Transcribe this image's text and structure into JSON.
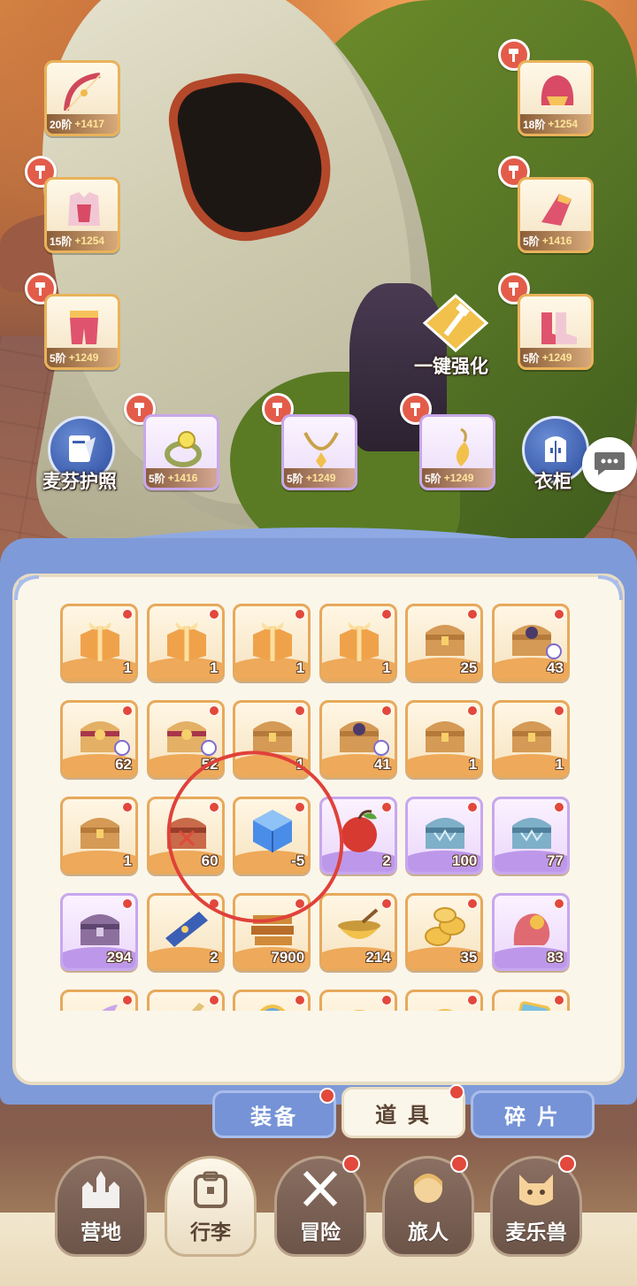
{
  "equipment": [
    {
      "id": "bow",
      "level": "20阶",
      "bonus": "+1417",
      "hammer": false,
      "rarity": "gold"
    },
    {
      "id": "helmet",
      "level": "18阶",
      "bonus": "+1254",
      "hammer": true,
      "rarity": "gold"
    },
    {
      "id": "armor",
      "level": "15阶",
      "bonus": "+1254",
      "hammer": true,
      "rarity": "gold"
    },
    {
      "id": "gloves",
      "level": "5阶",
      "bonus": "+1416",
      "hammer": true,
      "rarity": "gold"
    },
    {
      "id": "pants",
      "level": "5阶",
      "bonus": "+1249",
      "hammer": true,
      "rarity": "gold"
    },
    {
      "id": "boots",
      "level": "5阶",
      "bonus": "+1249",
      "hammer": true,
      "rarity": "gold"
    },
    {
      "id": "ring",
      "level": "5阶",
      "bonus": "+1416",
      "hammer": true,
      "rarity": "purple"
    },
    {
      "id": "necklace",
      "level": "5阶",
      "bonus": "+1249",
      "hammer": true,
      "rarity": "purple"
    },
    {
      "id": "earring",
      "level": "5阶",
      "bonus": "+1249",
      "hammer": true,
      "rarity": "purple"
    }
  ],
  "buttons": {
    "passport": "麦芬护照",
    "wardrobe": "衣柜",
    "upgrade_all": "一键强化"
  },
  "inventory": {
    "items": [
      {
        "icon": "gift-box",
        "count": "1",
        "rarity": "gold"
      },
      {
        "icon": "gift-box",
        "count": "1",
        "rarity": "gold"
      },
      {
        "icon": "gift-box",
        "count": "1",
        "rarity": "gold"
      },
      {
        "icon": "gift-box",
        "count": "1",
        "rarity": "gold"
      },
      {
        "icon": "treasure-chest",
        "count": "25",
        "rarity": "gold"
      },
      {
        "icon": "treasure-chest-badge",
        "count": "43",
        "rarity": "gold"
      },
      {
        "icon": "fancy-chest",
        "count": "62",
        "rarity": "gold"
      },
      {
        "icon": "fancy-chest",
        "count": "52",
        "rarity": "gold"
      },
      {
        "icon": "treasure-chest",
        "count": "1",
        "rarity": "gold"
      },
      {
        "icon": "treasure-chest-badge",
        "count": "41",
        "rarity": "gold"
      },
      {
        "icon": "treasure-chest",
        "count": "1",
        "rarity": "gold"
      },
      {
        "icon": "treasure-chest",
        "count": "1",
        "rarity": "gold"
      },
      {
        "icon": "treasure-chest",
        "count": "1",
        "rarity": "gold"
      },
      {
        "icon": "red-treasure-chest",
        "count": "60",
        "rarity": "gold"
      },
      {
        "icon": "blue-crystal-cube",
        "count": "-5",
        "rarity": "gold"
      },
      {
        "icon": "apple",
        "count": "2",
        "rarity": "purple"
      },
      {
        "icon": "steel-chest",
        "count": "100",
        "rarity": "purple"
      },
      {
        "icon": "steel-chest",
        "count": "77",
        "rarity": "purple"
      },
      {
        "icon": "purple-chest",
        "count": "294",
        "rarity": "purple"
      },
      {
        "icon": "scroll-banner",
        "count": "2",
        "rarity": "gold"
      },
      {
        "icon": "wood-planks",
        "count": "7900",
        "rarity": "gold"
      },
      {
        "icon": "golden-bowl",
        "count": "214",
        "rarity": "gold"
      },
      {
        "icon": "gold-coins",
        "count": "35",
        "rarity": "gold"
      },
      {
        "icon": "pink-plush",
        "count": "83",
        "rarity": "purple"
      },
      {
        "icon": "feather",
        "count": "",
        "rarity": "gold"
      },
      {
        "icon": "horn",
        "count": "",
        "rarity": "gold"
      },
      {
        "icon": "mirror",
        "count": "",
        "rarity": "gold"
      },
      {
        "icon": "ribbon",
        "count": "",
        "rarity": "gold"
      },
      {
        "icon": "gold-ring",
        "count": "",
        "rarity": "gold"
      },
      {
        "icon": "card",
        "count": "",
        "rarity": "gold"
      }
    ]
  },
  "panel_tabs": [
    {
      "label": "装备",
      "active": false,
      "dot": true
    },
    {
      "label": "道 具",
      "active": true,
      "dot": true
    },
    {
      "label": "碎 片",
      "active": false,
      "dot": false
    }
  ],
  "nav": [
    {
      "label": "营地",
      "icon": "castle-icon",
      "active": false,
      "dot": false
    },
    {
      "label": "行李",
      "icon": "backpack-icon",
      "active": true,
      "dot": false
    },
    {
      "label": "冒险",
      "icon": "crossed-swords-icon",
      "active": false,
      "dot": true
    },
    {
      "label": "旅人",
      "icon": "traveler-icon",
      "active": false,
      "dot": true
    },
    {
      "label": "麦乐兽",
      "icon": "pet-icon",
      "active": false,
      "dot": true
    }
  ],
  "colors": {
    "accent_red": "#e2483b",
    "panel_blue": "#7f9ad8",
    "annotation_circle": "#e0413a"
  }
}
